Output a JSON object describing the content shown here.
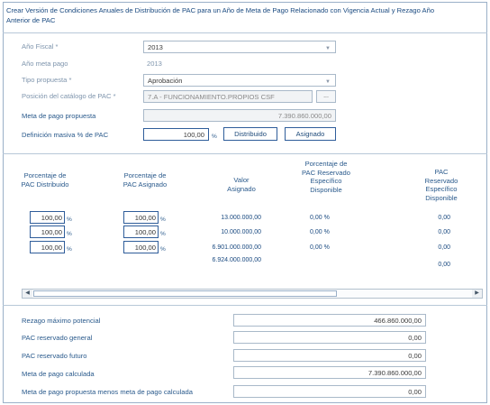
{
  "title": "Crear Versión de Condiciones Anuales de Distribución de PAC para un Año de Meta de Pago Relacionado con Vigencia Actual y Rezago Año Anterior de PAC",
  "form": {
    "anio_fiscal": {
      "label": "Año Fiscal *",
      "value": "2013"
    },
    "anio_meta": {
      "label": "Año meta pago",
      "value": "2013"
    },
    "tipo_propuesta": {
      "label": "Tipo propuesta *",
      "value": "Aprobación"
    },
    "posicion": {
      "label": "Posición del catálogo de PAC *",
      "value": "7.A - FUNCIONAMIENTO.PROPIOS CSF",
      "button": "..."
    },
    "meta_pago": {
      "label": "Meta de pago propuesta",
      "value": "7.390.860.000,00"
    },
    "definicion": {
      "label": "Definición masiva % de PAC",
      "value": "100,00",
      "unit": "%"
    }
  },
  "buttons": {
    "distribuido": "Distribuido",
    "asignado": "Asignado"
  },
  "table": {
    "headers": {
      "pct_distribuido": "Porcentaje de PAC Distribuido",
      "pct_asignado": "Porcentaje de PAC Asignado",
      "valor_asignado": "Valor Asignado",
      "pct_reservado": "Porcentaje de PAC Reservado Específico Disponible",
      "pac_reservado": "PAC Reservado Específico Disponible"
    },
    "unit": "%",
    "rows": [
      {
        "pct_dist": "100,00",
        "pct_asig": "100,00",
        "valor": "13.000.000,00",
        "pct_res": "0,00 %",
        "pac_res": "0,00"
      },
      {
        "pct_dist": "100,00",
        "pct_asig": "100,00",
        "valor": "10.000.000,00",
        "pct_res": "0,00 %",
        "pac_res": "0,00"
      },
      {
        "pct_dist": "100,00",
        "pct_asig": "100,00",
        "valor": "6.901.000.000,00",
        "pct_res": "0,00 %",
        "pac_res": "0,00"
      }
    ],
    "total": {
      "valor": "6.924.000.000,00",
      "pac_res": "0,00"
    }
  },
  "scrollbar": {
    "left_arrow": "◀",
    "right_arrow": "▶"
  },
  "summary": {
    "rezago": {
      "label": "Rezago máximo potencial",
      "value": "466.860.000,00"
    },
    "pac_general": {
      "label": "PAC reservado general",
      "value": "0,00"
    },
    "pac_futuro": {
      "label": "PAC reservado futuro",
      "value": "0,00"
    },
    "meta_calc": {
      "label": "Meta de pago calculada",
      "value": "7.390.860.000,00"
    },
    "diferencia": {
      "label": "Meta de pago propuesta menos meta de pago calculada",
      "value": "0,00"
    }
  }
}
